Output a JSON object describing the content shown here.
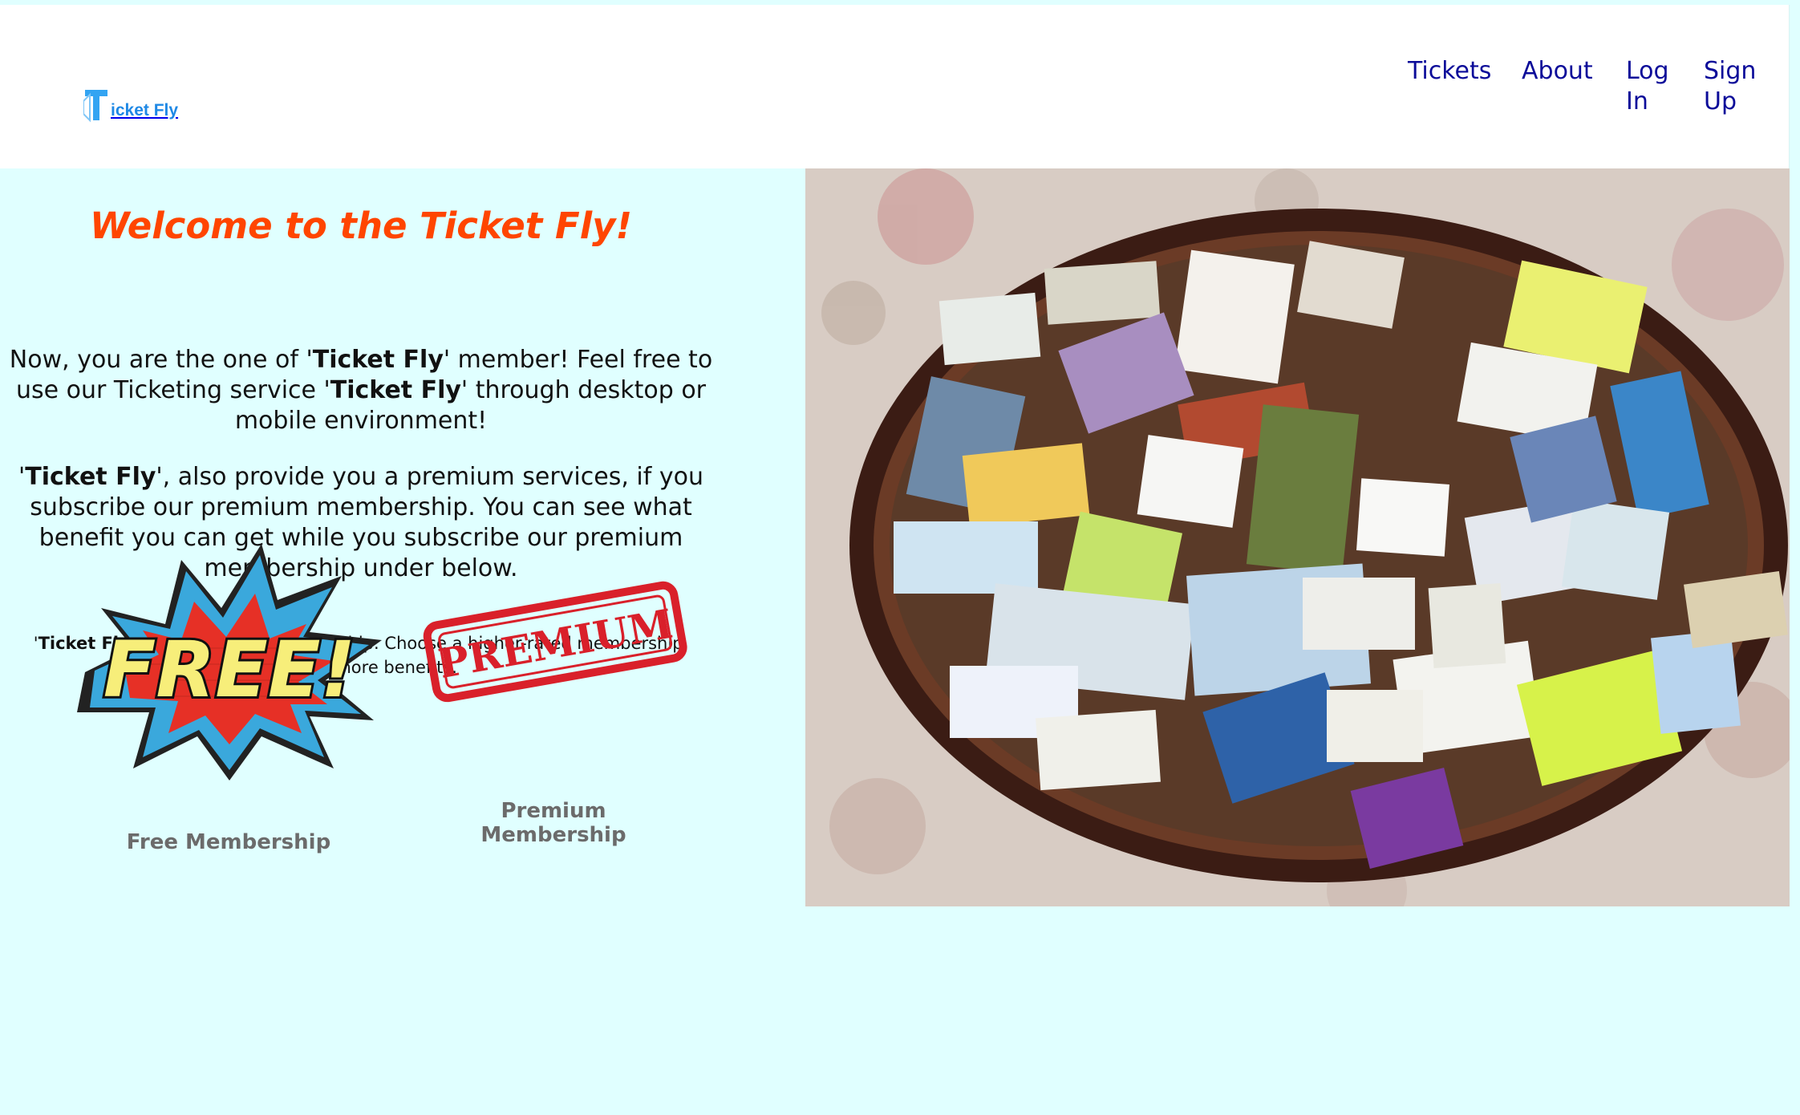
{
  "header": {
    "logo_text": "icket Fly",
    "nav": [
      "Tickets",
      "About",
      "Log In",
      "Sign Up"
    ]
  },
  "main": {
    "welcome": "Welcome to the Ticket Fly!",
    "para1_a": "Now, you are the one of '",
    "para1_bold": "Ticket Fly",
    "para1_b": "' member! Feel free to use our Ticketing service '",
    "para1_bold2": "Ticket Fly",
    "para1_c": "' through desktop or mobile environment!",
    "para2_a": "'",
    "para2_bold": "Ticket Fly",
    "para2_b": "', also provide you a premium services, if you subscribe our premium membership. You can see what benefit you can get while you subscribe our premium membership under below.",
    "para3_a": "'",
    "para3_bold": "Ticket Fly",
    "para3_b": "' has 2 different membership. Choose a higher-rated membership, and get more benefits."
  },
  "memberships": [
    {
      "badge_text": "FREE!",
      "caption": "Free Membership"
    },
    {
      "badge_text": "PREMIUM",
      "caption": "Premium Membership"
    }
  ],
  "colors": {
    "background": "#e0ffff",
    "welcome": "#ff4500",
    "nav_link": "#0b0b99",
    "logo_blue": "#1e88e5"
  }
}
